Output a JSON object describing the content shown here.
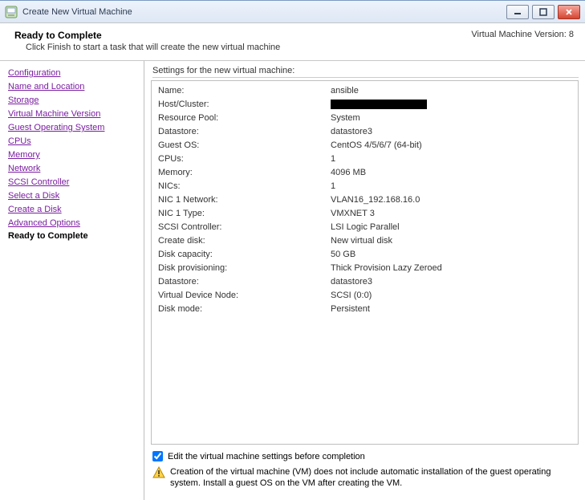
{
  "titlebar": {
    "title": "Create New Virtual Machine"
  },
  "header": {
    "title": "Ready to Complete",
    "subtitle": "Click Finish to start a task that will create the new virtual machine",
    "vm_version": "Virtual Machine Version: 8"
  },
  "sidebar": {
    "items": [
      "Configuration",
      "Name and Location",
      "Storage",
      "Virtual Machine Version",
      "Guest Operating System",
      "CPUs",
      "Memory",
      "Network",
      "SCSI Controller",
      "Select a Disk",
      "Create a Disk",
      "Advanced Options"
    ],
    "current": "Ready to Complete"
  },
  "content": {
    "settings_label": "Settings for the new virtual machine:",
    "rows": [
      {
        "k": "Name:",
        "v": "ansible"
      },
      {
        "k": "Host/Cluster:",
        "v": "[REDACTED]"
      },
      {
        "k": "Resource Pool:",
        "v": "System"
      },
      {
        "k": "Datastore:",
        "v": "datastore3"
      },
      {
        "k": "Guest OS:",
        "v": "CentOS 4/5/6/7 (64-bit)"
      },
      {
        "k": "CPUs:",
        "v": "1"
      },
      {
        "k": "Memory:",
        "v": "4096 MB"
      },
      {
        "k": "NICs:",
        "v": "1"
      },
      {
        "k": "NIC 1 Network:",
        "v": "VLAN16_192.168.16.0"
      },
      {
        "k": "NIC 1 Type:",
        "v": "VMXNET 3"
      },
      {
        "k": "SCSI Controller:",
        "v": "LSI Logic Parallel"
      },
      {
        "k": "Create disk:",
        "v": "New virtual disk"
      },
      {
        "k": "Disk capacity:",
        "v": "50 GB"
      },
      {
        "k": "Disk provisioning:",
        "v": "Thick Provision Lazy Zeroed"
      },
      {
        "k": "Datastore:",
        "v": "datastore3"
      },
      {
        "k": "Virtual Device Node:",
        "v": "SCSI (0:0)"
      },
      {
        "k": "Disk mode:",
        "v": "Persistent"
      }
    ],
    "edit_checkbox_label": "Edit the virtual machine settings before completion",
    "edit_checkbox_checked": true,
    "warning_text": "Creation of the virtual machine (VM) does not include automatic installation of the guest operating system. Install a guest OS on the VM after creating the VM."
  }
}
